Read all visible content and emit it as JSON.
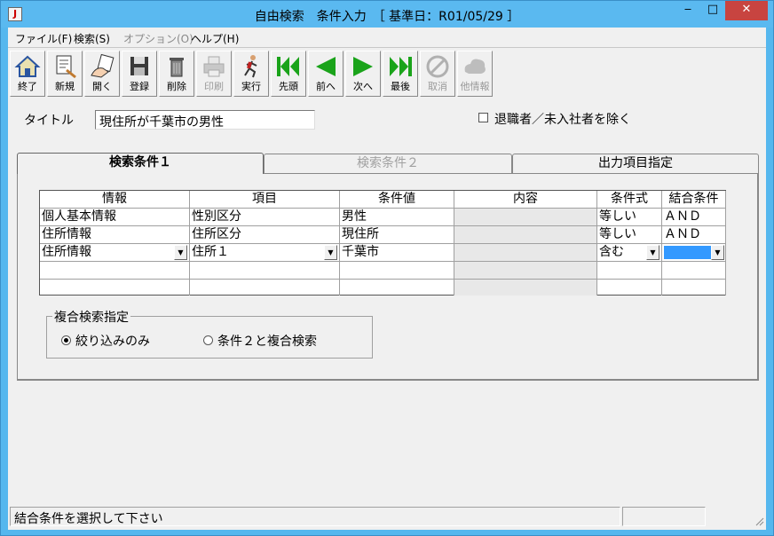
{
  "window": {
    "title": "自由検索　条件入力　［ 基準日：R01/05/29 ］",
    "app_icon_glyph": "J",
    "minimize_glyph": "‒",
    "maximize_glyph": "□",
    "close_glyph": "✕"
  },
  "menu": [
    {
      "label": "ファイル(F)",
      "disabled": false
    },
    {
      "label": "検索(S)",
      "disabled": false
    },
    {
      "label": "オプション(O)",
      "disabled": true
    },
    {
      "label": "ヘルプ(H)",
      "disabled": false
    }
  ],
  "toolbar": {
    "exit": "終了",
    "new": "新規",
    "open": "開く",
    "save": "登録",
    "delete": "削除",
    "print": "印刷",
    "run": "実行",
    "first": "先頭",
    "prev": "前へ",
    "next": "次へ",
    "last": "最後",
    "cancel": "取消",
    "other_info": "他情報"
  },
  "form": {
    "title_label": "タイトル",
    "title_value": "現住所が千葉市の男性",
    "exclude_label": "退職者／未入社者を除く",
    "exclude_checked": false
  },
  "tabs": {
    "tab1": "検索条件１",
    "tab2": "検索条件２",
    "tab3": "出力項目指定",
    "active": "tab1"
  },
  "grid": {
    "headers": {
      "info": "情報",
      "item": "項目",
      "value": "条件値",
      "content": "内容",
      "op": "条件式",
      "join": "結合条件"
    },
    "rows": [
      {
        "info": "個人基本情報",
        "item": "性別区分",
        "value": "男性",
        "content": "",
        "op": "等しい",
        "join": "ＡＮＤ"
      },
      {
        "info": "住所情報",
        "item": "住所区分",
        "value": "現住所",
        "content": "",
        "op": "等しい",
        "join": "ＡＮＤ"
      },
      {
        "info": "住所情報",
        "item": "住所１",
        "value": "千葉市",
        "content": "",
        "op": "含む",
        "join": ""
      }
    ]
  },
  "compound": {
    "title": "複合検索指定",
    "option1": "絞り込みのみ",
    "option2": "条件２と複合検索",
    "selected": "option1"
  },
  "status": {
    "message": "結合条件を選択して下さい",
    "pane2": ""
  },
  "colors": {
    "titlebar": "#5ab9f0",
    "close_button": "#c84440",
    "selection": "#3399ff",
    "nav_green": "#1aa31a"
  }
}
